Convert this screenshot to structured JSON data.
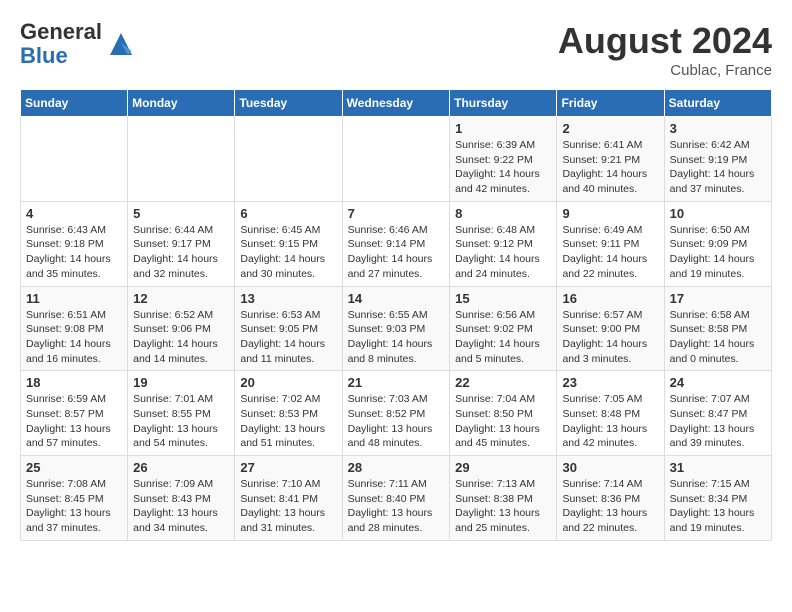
{
  "header": {
    "logo_line1": "General",
    "logo_line2": "Blue",
    "month_year": "August 2024",
    "location": "Cublac, France"
  },
  "days_of_week": [
    "Sunday",
    "Monday",
    "Tuesday",
    "Wednesday",
    "Thursday",
    "Friday",
    "Saturday"
  ],
  "weeks": [
    [
      {
        "day": "",
        "info": ""
      },
      {
        "day": "",
        "info": ""
      },
      {
        "day": "",
        "info": ""
      },
      {
        "day": "",
        "info": ""
      },
      {
        "day": "1",
        "info": "Sunrise: 6:39 AM\nSunset: 9:22 PM\nDaylight: 14 hours\nand 42 minutes."
      },
      {
        "day": "2",
        "info": "Sunrise: 6:41 AM\nSunset: 9:21 PM\nDaylight: 14 hours\nand 40 minutes."
      },
      {
        "day": "3",
        "info": "Sunrise: 6:42 AM\nSunset: 9:19 PM\nDaylight: 14 hours\nand 37 minutes."
      }
    ],
    [
      {
        "day": "4",
        "info": "Sunrise: 6:43 AM\nSunset: 9:18 PM\nDaylight: 14 hours\nand 35 minutes."
      },
      {
        "day": "5",
        "info": "Sunrise: 6:44 AM\nSunset: 9:17 PM\nDaylight: 14 hours\nand 32 minutes."
      },
      {
        "day": "6",
        "info": "Sunrise: 6:45 AM\nSunset: 9:15 PM\nDaylight: 14 hours\nand 30 minutes."
      },
      {
        "day": "7",
        "info": "Sunrise: 6:46 AM\nSunset: 9:14 PM\nDaylight: 14 hours\nand 27 minutes."
      },
      {
        "day": "8",
        "info": "Sunrise: 6:48 AM\nSunset: 9:12 PM\nDaylight: 14 hours\nand 24 minutes."
      },
      {
        "day": "9",
        "info": "Sunrise: 6:49 AM\nSunset: 9:11 PM\nDaylight: 14 hours\nand 22 minutes."
      },
      {
        "day": "10",
        "info": "Sunrise: 6:50 AM\nSunset: 9:09 PM\nDaylight: 14 hours\nand 19 minutes."
      }
    ],
    [
      {
        "day": "11",
        "info": "Sunrise: 6:51 AM\nSunset: 9:08 PM\nDaylight: 14 hours\nand 16 minutes."
      },
      {
        "day": "12",
        "info": "Sunrise: 6:52 AM\nSunset: 9:06 PM\nDaylight: 14 hours\nand 14 minutes."
      },
      {
        "day": "13",
        "info": "Sunrise: 6:53 AM\nSunset: 9:05 PM\nDaylight: 14 hours\nand 11 minutes."
      },
      {
        "day": "14",
        "info": "Sunrise: 6:55 AM\nSunset: 9:03 PM\nDaylight: 14 hours\nand 8 minutes."
      },
      {
        "day": "15",
        "info": "Sunrise: 6:56 AM\nSunset: 9:02 PM\nDaylight: 14 hours\nand 5 minutes."
      },
      {
        "day": "16",
        "info": "Sunrise: 6:57 AM\nSunset: 9:00 PM\nDaylight: 14 hours\nand 3 minutes."
      },
      {
        "day": "17",
        "info": "Sunrise: 6:58 AM\nSunset: 8:58 PM\nDaylight: 14 hours\nand 0 minutes."
      }
    ],
    [
      {
        "day": "18",
        "info": "Sunrise: 6:59 AM\nSunset: 8:57 PM\nDaylight: 13 hours\nand 57 minutes."
      },
      {
        "day": "19",
        "info": "Sunrise: 7:01 AM\nSunset: 8:55 PM\nDaylight: 13 hours\nand 54 minutes."
      },
      {
        "day": "20",
        "info": "Sunrise: 7:02 AM\nSunset: 8:53 PM\nDaylight: 13 hours\nand 51 minutes."
      },
      {
        "day": "21",
        "info": "Sunrise: 7:03 AM\nSunset: 8:52 PM\nDaylight: 13 hours\nand 48 minutes."
      },
      {
        "day": "22",
        "info": "Sunrise: 7:04 AM\nSunset: 8:50 PM\nDaylight: 13 hours\nand 45 minutes."
      },
      {
        "day": "23",
        "info": "Sunrise: 7:05 AM\nSunset: 8:48 PM\nDaylight: 13 hours\nand 42 minutes."
      },
      {
        "day": "24",
        "info": "Sunrise: 7:07 AM\nSunset: 8:47 PM\nDaylight: 13 hours\nand 39 minutes."
      }
    ],
    [
      {
        "day": "25",
        "info": "Sunrise: 7:08 AM\nSunset: 8:45 PM\nDaylight: 13 hours\nand 37 minutes."
      },
      {
        "day": "26",
        "info": "Sunrise: 7:09 AM\nSunset: 8:43 PM\nDaylight: 13 hours\nand 34 minutes."
      },
      {
        "day": "27",
        "info": "Sunrise: 7:10 AM\nSunset: 8:41 PM\nDaylight: 13 hours\nand 31 minutes."
      },
      {
        "day": "28",
        "info": "Sunrise: 7:11 AM\nSunset: 8:40 PM\nDaylight: 13 hours\nand 28 minutes."
      },
      {
        "day": "29",
        "info": "Sunrise: 7:13 AM\nSunset: 8:38 PM\nDaylight: 13 hours\nand 25 minutes."
      },
      {
        "day": "30",
        "info": "Sunrise: 7:14 AM\nSunset: 8:36 PM\nDaylight: 13 hours\nand 22 minutes."
      },
      {
        "day": "31",
        "info": "Sunrise: 7:15 AM\nSunset: 8:34 PM\nDaylight: 13 hours\nand 19 minutes."
      }
    ]
  ]
}
